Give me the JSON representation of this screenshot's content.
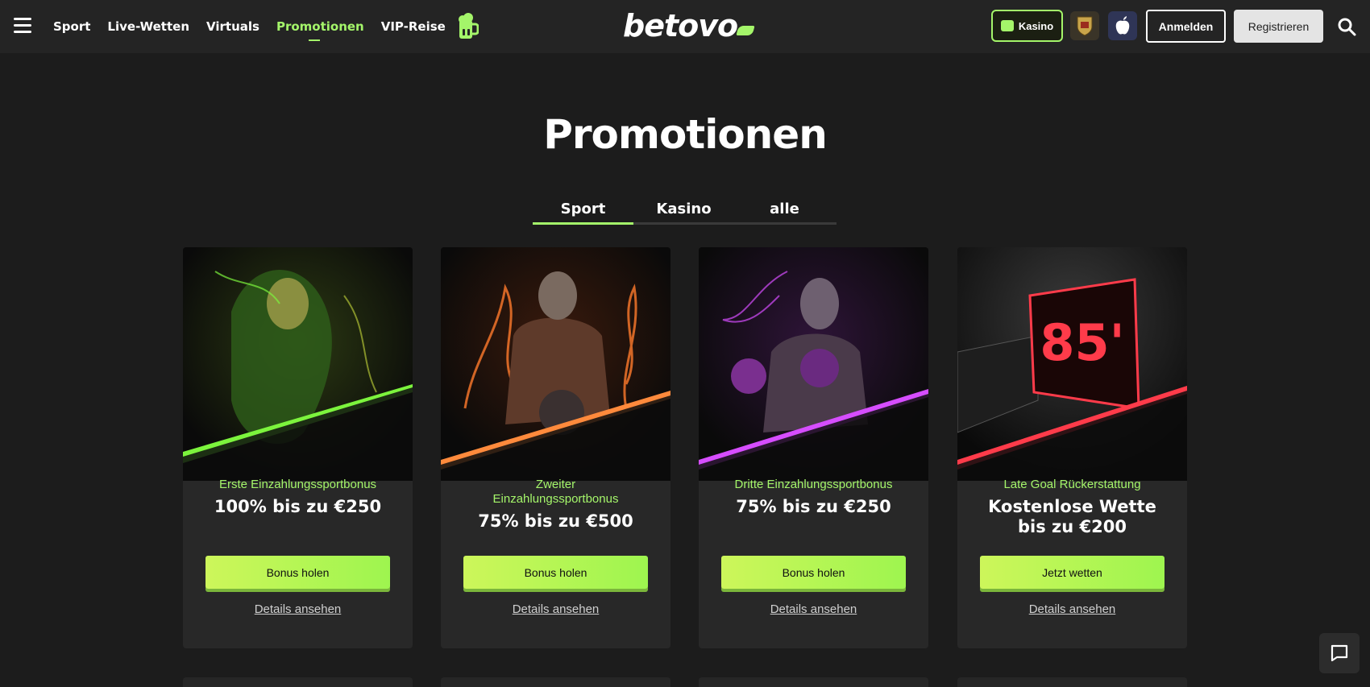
{
  "nav": {
    "items": [
      {
        "label": "Sport",
        "active": false
      },
      {
        "label": "Live-Wetten",
        "active": false
      },
      {
        "label": "Virtuals",
        "active": false
      },
      {
        "label": "Promotionen",
        "active": true
      },
      {
        "label": "VIP-Reise",
        "active": false
      }
    ]
  },
  "logo": {
    "text": "betovo"
  },
  "header": {
    "kasino_label": "Kasino",
    "login_label": "Anmelden",
    "register_label": "Registrieren"
  },
  "page": {
    "title": "Promotionen"
  },
  "tabs": [
    {
      "label": "Sport",
      "active": true
    },
    {
      "label": "Kasino",
      "active": false
    },
    {
      "label": "alle",
      "active": false
    }
  ],
  "promos": [
    {
      "subtitle": "Erste Einzahlungssportbonus",
      "headline": "100% bis zu €250",
      "cta": "Bonus holen",
      "details": "Details ansehen",
      "accent": "#7cf43d"
    },
    {
      "subtitle": "Zweiter Einzahlungssportbonus",
      "headline": "75% bis zu €500",
      "cta": "Bonus holen",
      "details": "Details ansehen",
      "accent": "#ff8a3c"
    },
    {
      "subtitle": "Dritte Einzahlungssportbonus",
      "headline": "75% bis zu €250",
      "cta": "Bonus holen",
      "details": "Details ansehen",
      "accent": "#d64dff"
    },
    {
      "subtitle": "Late Goal Rückerstattung",
      "headline": "Kostenlose Wette bis zu €200",
      "cta": "Jetzt wetten",
      "details": "Details ansehen",
      "accent": "#ff3b4a",
      "scoreboard": "85'"
    }
  ],
  "colors": {
    "accent": "#a4f56a",
    "background": "#1c1c1c",
    "topbar": "#242424"
  }
}
